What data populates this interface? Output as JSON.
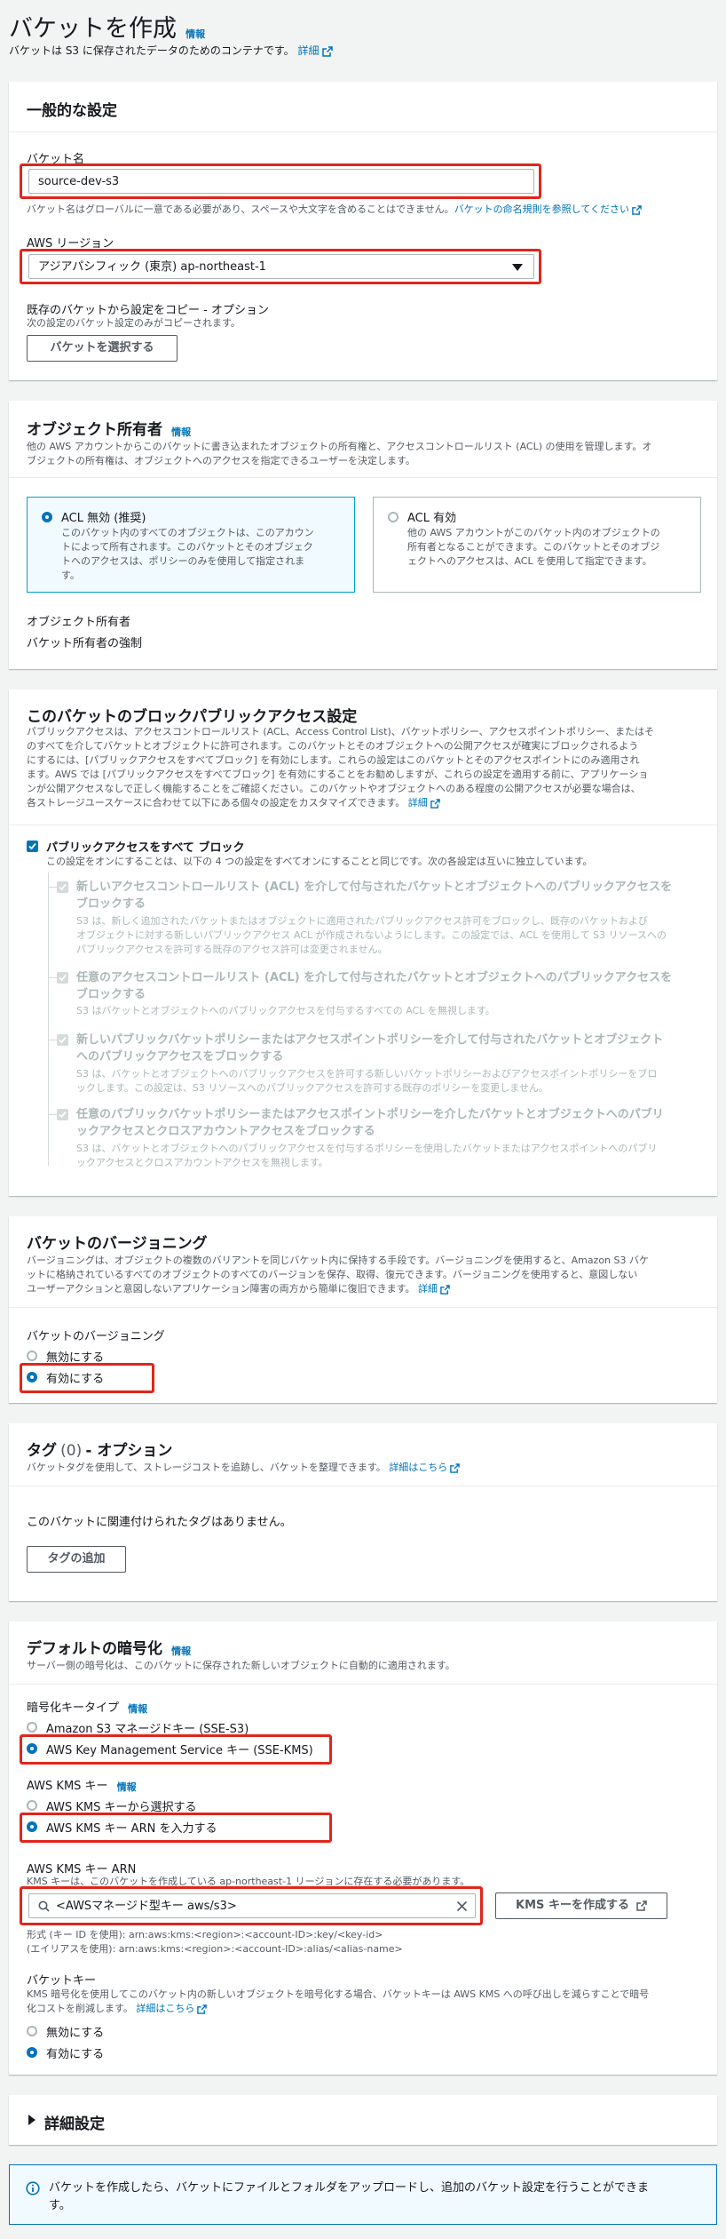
{
  "header": {
    "title": "バケットを作成",
    "info": "情報",
    "subtitle": "バケットは S3 に保存されたデータのためのコンテナです。",
    "detail_link": "詳細"
  },
  "general": {
    "title": "一般的な設定",
    "bucket_name_label": "バケット名",
    "bucket_name_value": "source-dev-s3",
    "bucket_name_hint": "バケット名はグローバルに一意である必要があり、スペースや大文字を含めることはできません。",
    "naming_rules_link": "バケットの命名規則を参照してください",
    "region_label": "AWS リージョン",
    "region_value": "アジアパシフィック (東京) ap-northeast-1",
    "copy_label": "既存のバケットから設定をコピー - オプション",
    "copy_hint": "次の設定のバケット設定のみがコピーされます。",
    "choose_bucket_button": "バケットを選択する"
  },
  "ownership": {
    "title": "オブジェクト所有者",
    "info": "情報",
    "desc1": "他の AWS アカウントからこのバケットに書き込まれたオブジェクトの所有権と、アクセスコントロールリスト (ACL) の使用を管理します。オ",
    "desc2": "ブジェクトの所有権は、オブジェクトへのアクセスを指定できるユーザーを決定します。",
    "option1_title": "ACL 無効 (推奨)",
    "option1_desc": [
      "このバケット内のすべてのオブジェクトは、このアカウン",
      "トによって所有されます。このバケットとそのオブジェク",
      "トへのアクセスは、ポリシーのみを使用して指定されま",
      "す。"
    ],
    "option2_title": "ACL 有効",
    "option2_desc": [
      "他の AWS アカウントがこのバケット内のオブジェクトの",
      "所有者となることができます。このバケットとそのオブジ",
      "ェクトへのアクセスは、ACL を使用して指定できます。"
    ],
    "owner_label": "オブジェクト所有者",
    "owner_value": "バケット所有者の強制"
  },
  "public_access": {
    "title": "このバケットのブロックパブリックアクセス設定",
    "desc": [
      "パブリックアクセスは、アクセスコントロールリスト (ACL、Access Control List)、バケットポリシー、アクセスポイントポリシー、またはそ",
      "のすべてを介してバケットとオブジェクトに許可されます。このバケットとそのオブジェクトへの公開アクセスが確実にブロックされるよう",
      "にするには、[パブリックアクセスをすべてブロック] を有効にします。これらの設定はこのバケットとそのアクセスポイントにのみ適用され",
      "ます。AWS では [パブリックアクセスをすべてブロック] を有効にすることをお勧めしますが、これらの設定を適用する前に、アプリケーショ",
      "ンが公開アクセスなしで正しく機能することをご確認ください。このバケットやオブジェクトへのある程度の公開アクセスが必要な場合は、",
      "各ストレージユースケースに合わせて以下にある個々の設定をカスタマイズできます。"
    ],
    "detail_link": "詳細",
    "block_all_title": "パブリックアクセスをすべて ブロック",
    "block_all_desc": "この設定をオンにすることは、以下の 4 つの設定をすべてオンにすることと同じです。次の各設定は互いに独立しています。",
    "items": [
      {
        "title": [
          "新しいアクセスコントロールリスト (ACL) を介して付与されたバケットとオブジェクトへのパブリックアクセスを",
          "ブロックする"
        ],
        "desc": [
          "S3 は、新しく追加されたバケットまたはオブジェクトに適用されたパブリックアクセス許可をブロックし、既存のバケットおよび",
          "オブジェクトに対する新しいパブリックアクセス ACL が作成されないようにします。この設定では、ACL を使用して S3 リソースへの",
          "パブリックアクセスを許可する既存のアクセス許可は変更されません。"
        ]
      },
      {
        "title": [
          "任意のアクセスコントロールリスト (ACL) を介して付与されたバケットとオブジェクトへのパブリックアクセスを",
          "ブロックする"
        ],
        "desc": [
          "S3 はバケットとオブジェクトへのパブリックアクセスを付与するすべての ACL を無視します。"
        ]
      },
      {
        "title": [
          "新しいパブリックバケットポリシーまたはアクセスポイントポリシーを介して付与されたバケットとオブジェクト",
          "へのパブリックアクセスをブロックする"
        ],
        "desc": [
          "S3 は、バケットとオブジェクトへのパブリックアクセスを許可する新しいバケットポリシーおよびアクセスポイントポリシーをブロ",
          "ックします。この設定は、S3 リソースへのパブリックアクセスを許可する既存のポリシーを変更しません。"
        ]
      },
      {
        "title": [
          "任意のパブリックバケットポリシーまたはアクセスポイントポリシーを介したバケットとオブジェクトへのパブリ",
          "ックアクセスとクロスアカウントアクセスをブロックする"
        ],
        "desc": [
          "S3 は、バケットとオブジェクトへのパブリックアクセスを付与するポリシーを使用したバケットまたはアクセスポイントへのパブリ",
          "ックアクセスとクロスアカウントアクセスを無視します。"
        ]
      }
    ]
  },
  "versioning": {
    "title": "バケットのバージョニング",
    "desc": [
      "バージョニングは、オブジェクトの複数のバリアントを同じバケット内に保持する手段です。バージョニングを使用すると、Amazon S3 バケ",
      "ットに格納されているすべてのオブジェクトのすべてのバージョンを保存、取得、復元できます。バージョニングを使用すると、意図しない",
      "ユーザーアクションと意図しないアプリケーション障害の両方から簡単に復旧できます。"
    ],
    "detail_link": "詳細",
    "field_label": "バケットのバージョニング",
    "option_disable": "無効にする",
    "option_enable": "有効にする"
  },
  "tags": {
    "title_prefix": "タグ",
    "count": "(0)",
    "title_suffix": "- オプション",
    "desc": "バケットタグを使用して、ストレージコストを追跡し、バケットを整理できます。",
    "detail_link": "詳細はこちら",
    "empty_text": "このバケットに関連付けられたタグはありません。",
    "add_button": "タグの追加"
  },
  "encryption": {
    "title": "デフォルトの暗号化",
    "info": "情報",
    "desc": "サーバー側の暗号化は、このバケットに保存された新しいオブジェクトに自動的に適用されます。",
    "key_type_label": "暗号化キータイプ",
    "key_type_info": "情報",
    "key_type_option1": "Amazon S3 マネージドキー (SSE-S3)",
    "key_type_option2": "AWS Key Management Service キー (SSE-KMS)",
    "kms_label": "AWS KMS キー",
    "kms_info": "情報",
    "kms_option1": "AWS KMS キーから選択する",
    "kms_option2": "AWS KMS キー ARN を入力する",
    "arn_label": "AWS KMS キー ARN",
    "arn_hint": "KMS キーは、このバケットを作成している ap-northeast-1 リージョンに存在する必要があります。",
    "arn_value": "<AWSマネージド型キー aws/s3>",
    "create_key_button": "KMS キーを作成する",
    "format1": "形式 (キー ID を使用): arn:aws:kms:<region>:<account-ID>:key/<key-id>",
    "format2": "(エイリアスを使用): arn:aws:kms:<region>:<account-ID>:alias/<alias-name>",
    "bucket_key_label": "バケットキー",
    "bucket_key_desc1": "KMS 暗号化を使用してこのバケット内の新しいオブジェクトを暗号化する場合、バケットキーは AWS KMS への呼び出しを減らすことで暗号",
    "bucket_key_desc2": "化コストを削減します。",
    "bucket_key_link": "詳細はこちら",
    "bucket_key_option1": "無効にする",
    "bucket_key_option2": "有効にする"
  },
  "advanced": {
    "title": "詳細設定"
  },
  "notice": {
    "line1": "バケットを作成したら、バケットにファイルとフォルダをアップロードし、追加のバケット設定を行うことができま",
    "line2": "す。"
  },
  "colors": {
    "accent": "#0073bb",
    "highlight": "#e1251b",
    "panel": "#ffffff",
    "background": "#f2f3f3"
  }
}
